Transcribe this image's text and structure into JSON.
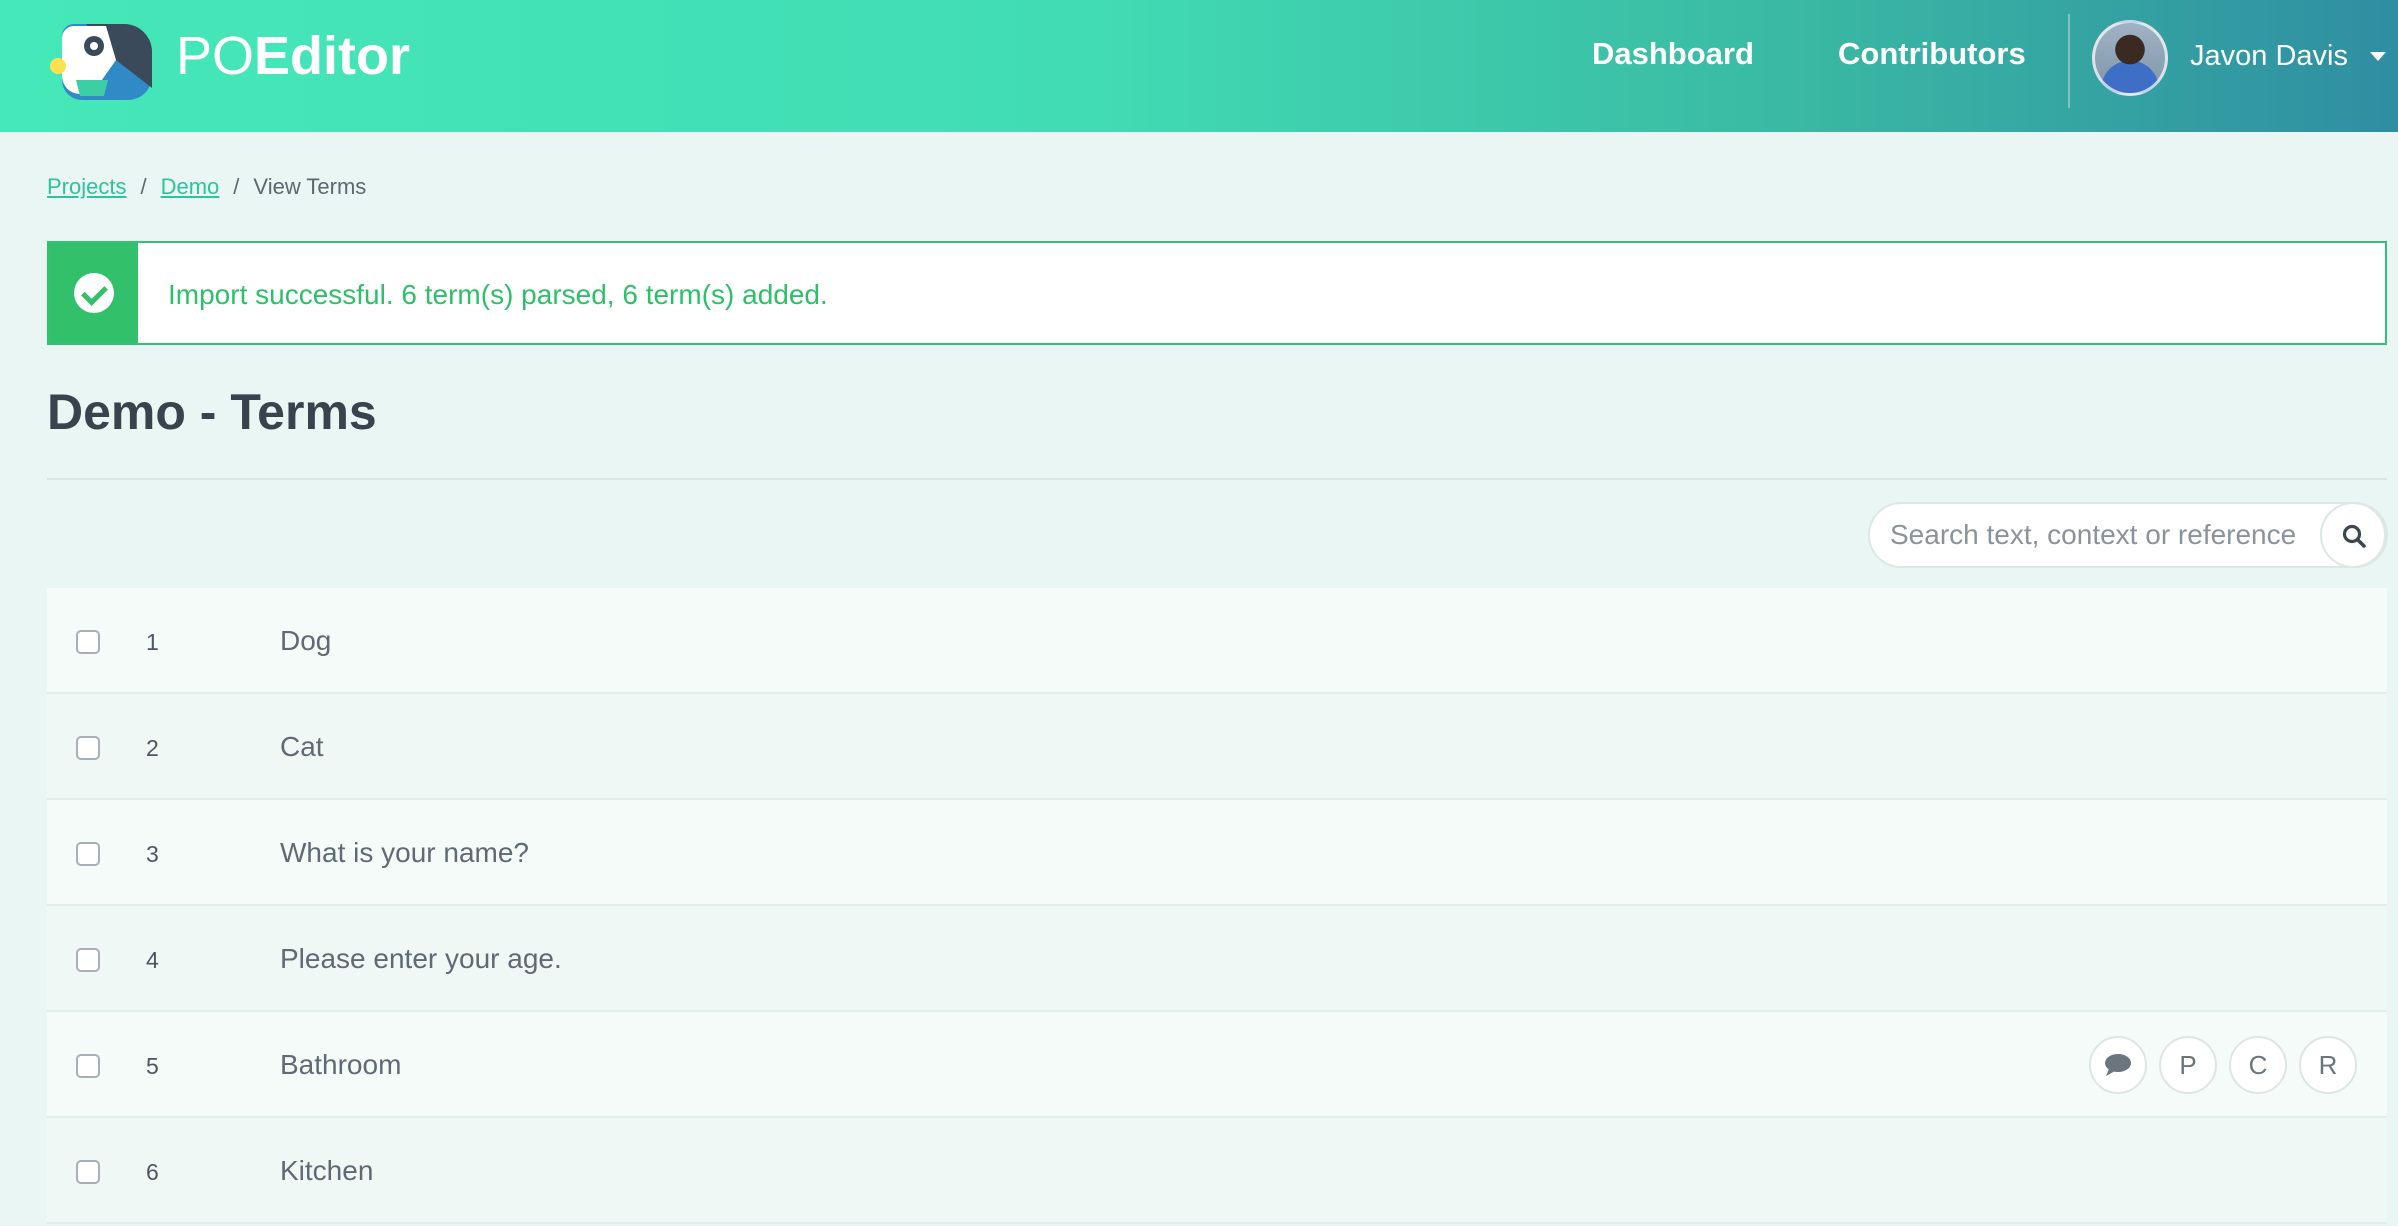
{
  "header": {
    "logo_po": "PO",
    "logo_editor": "Editor",
    "nav": {
      "dashboard": "Dashboard",
      "contributors": "Contributors"
    },
    "user_name": "Javon Davis"
  },
  "breadcrumb": {
    "projects": "Projects",
    "demo": "Demo",
    "current": "View Terms",
    "separator": "/"
  },
  "alert": {
    "message": "Import successful. 6 term(s) parsed, 6 term(s) added.",
    "type": "success"
  },
  "page": {
    "title": "Demo - Terms"
  },
  "search": {
    "placeholder": "Search text, context or reference",
    "value": ""
  },
  "terms": [
    {
      "number": "1",
      "text": "Dog"
    },
    {
      "number": "2",
      "text": "Cat"
    },
    {
      "number": "3",
      "text": "What is your name?"
    },
    {
      "number": "4",
      "text": "Please enter your age."
    },
    {
      "number": "5",
      "text": "Bathroom"
    },
    {
      "number": "6",
      "text": "Kitchen"
    }
  ],
  "row_actions": {
    "comment_icon": "comment-icon",
    "plural": "P",
    "context": "C",
    "reference": "R"
  },
  "colors": {
    "brand_green": "#45e8b9",
    "success_green": "#33c06b",
    "link_green": "#2bc49b",
    "background": "#eaf6f3"
  }
}
